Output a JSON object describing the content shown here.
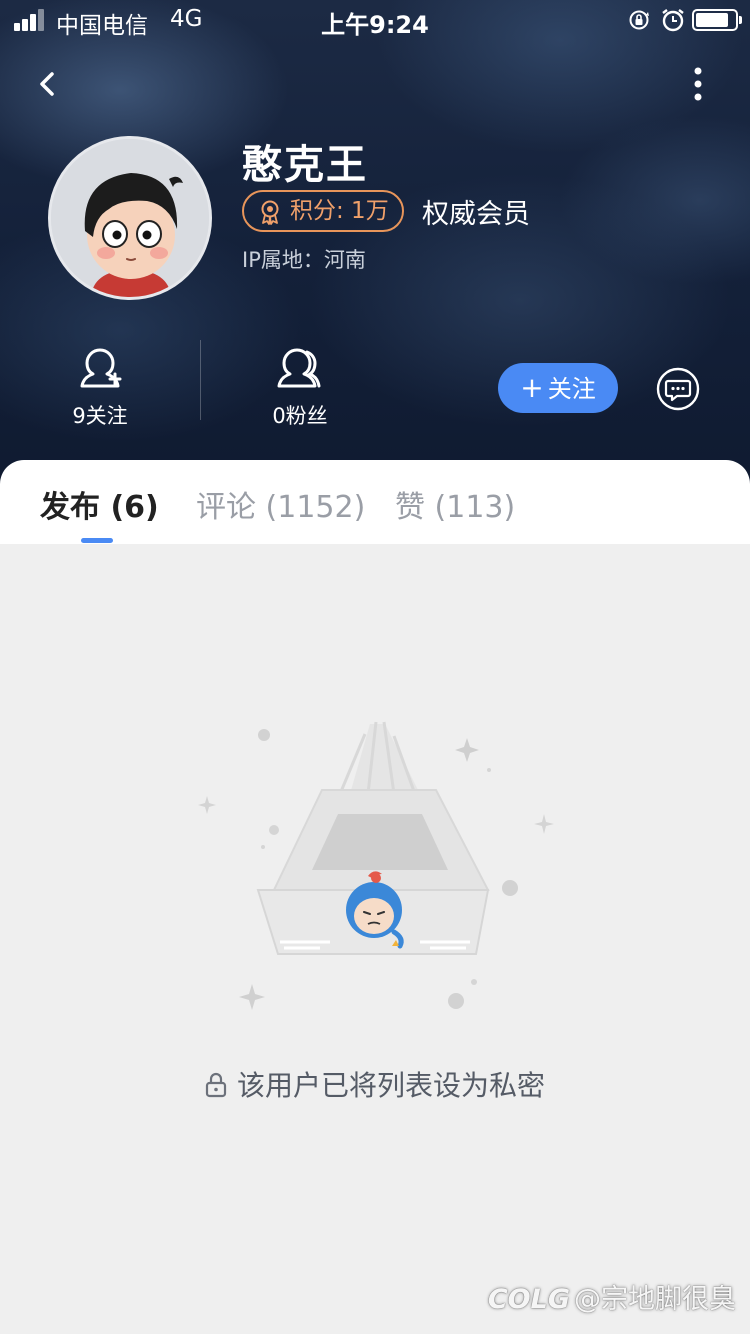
{
  "status_bar": {
    "carrier": "中国电信",
    "network": "4G",
    "time": "上午9:24",
    "icons": [
      "signal-icon",
      "rotation-lock-icon",
      "alarm-icon",
      "battery-icon"
    ]
  },
  "nav": {
    "back_icon": "chevron-left-icon",
    "more_icon": "more-vertical-icon"
  },
  "profile": {
    "username": "憨克王",
    "points_label": "积分: 1万",
    "member_title": "权威会员",
    "ip_location": "IP属地：河南"
  },
  "stats": {
    "following_label": "9关注",
    "followers_label": "0粉丝"
  },
  "actions": {
    "follow_label": "关注",
    "message_icon": "chat-bubble-icon"
  },
  "tabs": [
    {
      "label": "发布 (6)",
      "active": true
    },
    {
      "label": "评论 (1152)",
      "active": false
    },
    {
      "label": "赞 (113)",
      "active": false
    }
  ],
  "empty_state": {
    "message": "该用户已将列表设为私密"
  },
  "watermark": {
    "logo": "COLG",
    "text": "@宗地脚很臭"
  },
  "colors": {
    "accent": "#4a8af4",
    "points_badge": "#e8955a",
    "header_bg": "#16233c"
  }
}
